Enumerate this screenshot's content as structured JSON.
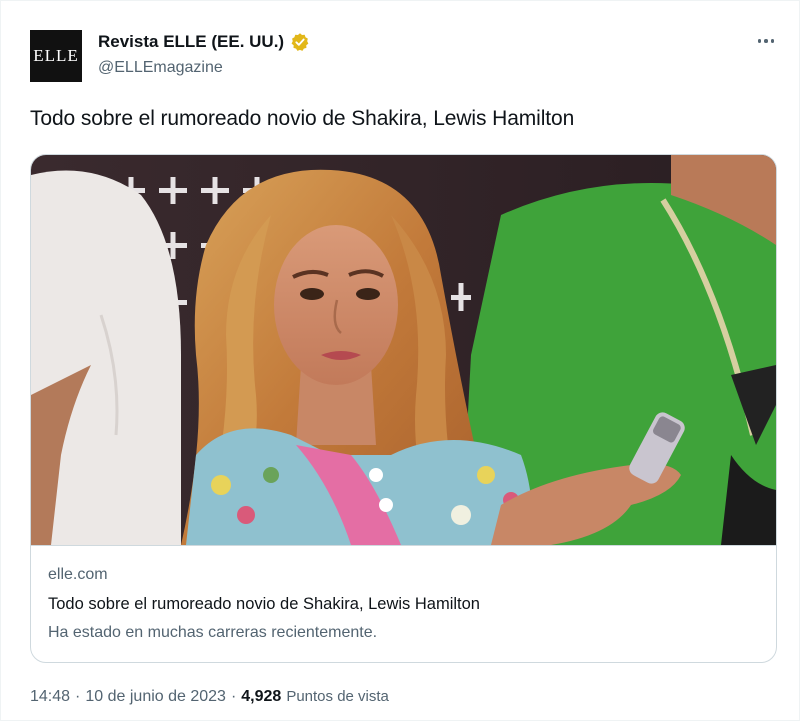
{
  "author": {
    "avatar_text": "ELLE",
    "display_name": "Revista ELLE (EE. UU.)",
    "handle": "@ELLEmagazine"
  },
  "icons": {
    "verified": "verified-badge-icon",
    "more": "more-options-icon"
  },
  "colors": {
    "verified_gold": "#e2b719",
    "text_primary": "#0f1419",
    "text_secondary": "#536471",
    "card_border": "#cfd9de",
    "photo_green_shirt": "#3fa33a"
  },
  "tweet": {
    "text": "Todo sobre el rumoreado novio de Shakira, Lewis Hamilton"
  },
  "card": {
    "domain": "elle.com",
    "title": "Todo sobre el rumoreado novio de Shakira, Lewis Hamilton",
    "description": "Ha estado en muchas carreras recientemente."
  },
  "meta": {
    "time": "14:48",
    "separator1": "·",
    "date": "10 de junio de 2023",
    "separator2": "·",
    "views": "4,928",
    "views_label": "Puntos de vista"
  }
}
